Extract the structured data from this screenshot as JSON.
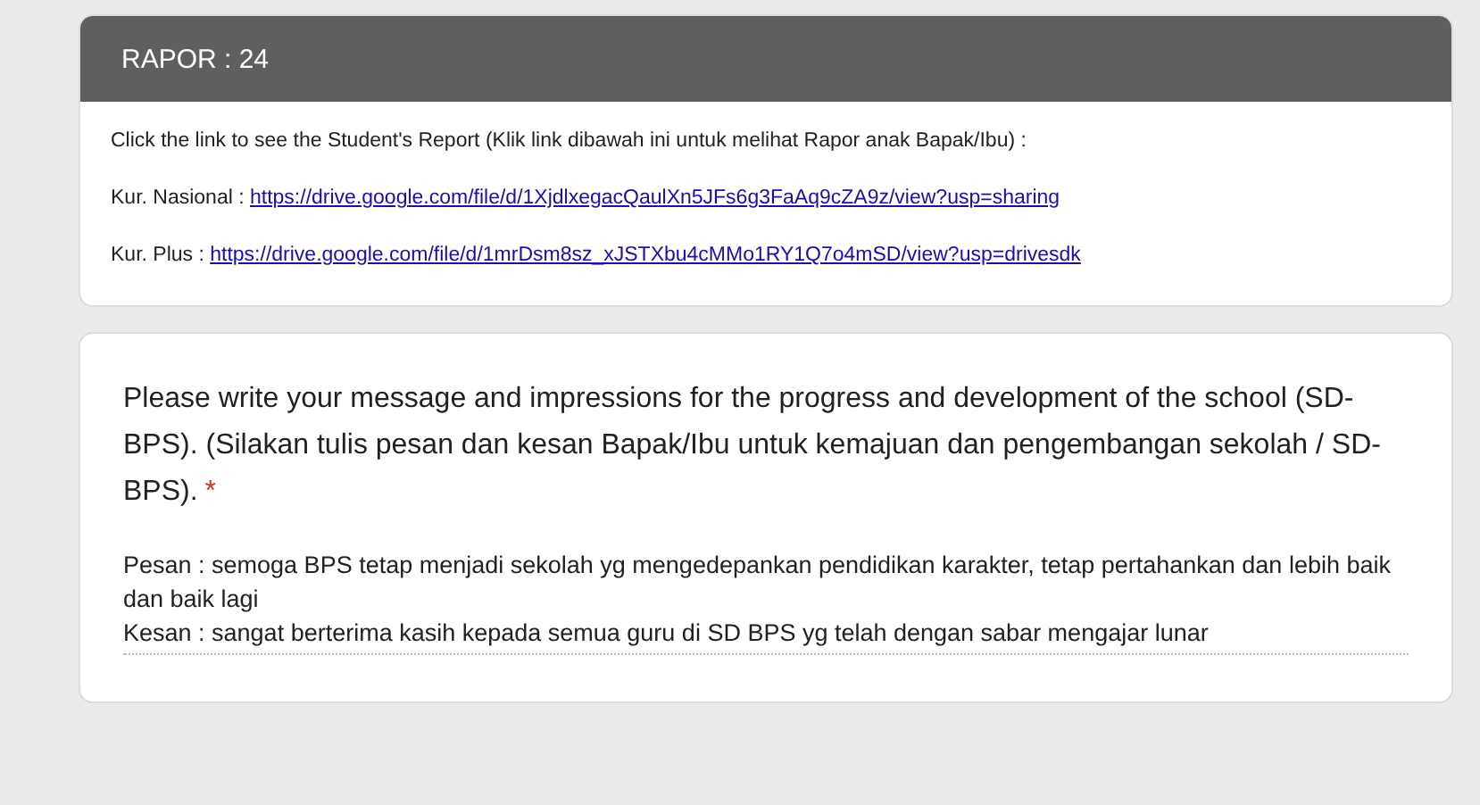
{
  "report_card": {
    "title": "RAPOR : 24",
    "intro": "Click the link to see the Student's Report (Klik link dibawah ini untuk melihat Rapor anak Bapak/Ibu) :",
    "links": [
      {
        "label": "Kur. Nasional :",
        "url": "https://drive.google.com/file/d/1XjdlxegacQaulXn5JFs6g3FaAq9cZA9z/view?usp=sharing"
      },
      {
        "label": "Kur. Plus :",
        "url": "https://drive.google.com/file/d/1mrDsm8sz_xJSTXbu4cMMo1RY1Q7o4mSD/view?usp=drivesdk"
      }
    ]
  },
  "question": {
    "text": "Please write your message and impressions for the progress and development of the school (SD-BPS). (Silakan tulis pesan dan kesan Bapak/Ibu untuk kemajuan dan pengembangan sekolah / SD-BPS).",
    "required": true,
    "required_mark": "*",
    "answer": "Pesan : semoga BPS tetap menjadi sekolah yg mengedepankan pendidikan karakter, tetap pertahankan dan lebih baik dan baik lagi\nKesan : sangat berterima kasih kepada semua guru di SD BPS yg telah dengan sabar mengajar lunar"
  }
}
